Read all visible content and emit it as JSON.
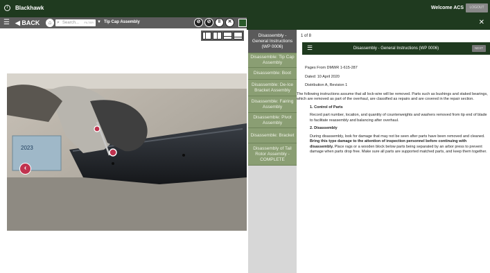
{
  "app": {
    "title": "Blackhawk",
    "welcome": "Welcome ACS",
    "logout_label": "LOGOUT"
  },
  "toolbar": {
    "back_label": "◀ BACK",
    "search_placeholder": "Search...",
    "filter_label": "FILTER",
    "breadcrumb": "Tip Cap Assembly",
    "icons": [
      "no-touch-icon",
      "no-touch-icon",
      "pause-icon",
      "close-icon",
      "square-icon"
    ]
  },
  "nav": {
    "items": [
      {
        "label": "Disassembly - General Instructions (WP 0006)",
        "active": true
      },
      {
        "label": "Disassemble: Tip Cap Assembly",
        "active": false
      },
      {
        "label": "Disassemble: Boot",
        "active": false
      },
      {
        "label": "Disassemble: De-Ice Bracket Assembly",
        "active": false
      },
      {
        "label": "Disassemble: Fairing Assembly",
        "active": false
      },
      {
        "label": "Disassemble: Pivot Assembly",
        "active": false
      },
      {
        "label": "Disassemble: Bracket",
        "active": false
      },
      {
        "label": "Disassembly of Tail Rotor Assembly - COMPLETE",
        "active": false
      }
    ]
  },
  "content": {
    "pager": "1 of 8",
    "header_title": "Disassembly - General Instructions (WP 0006)",
    "next_label": "NEXT",
    "pages_from": "Pages From DMWR 1-615-287",
    "dated": "Dated: 10 April 2020",
    "distribution": "Distribution A, Revision 1",
    "intro": "The following instructions assume that all lock-wire will be removed. Parts such as bushings and staked bearings, which are removed as part of the overhaul, are classified as repairs and are covered in the repair section.",
    "sec1_title": "1. Control of Parts",
    "sec1_body": "Record part number, location, and quantity of counterweights and washers removed from tip end of blade to facilitate reassembly and balancing after overhaul.",
    "sec2_title": "2. Disassembly",
    "sec2_body_a": "During disassembly, look for damage that may not be seen after parts have been removed and cleaned. ",
    "sec2_body_bold": "Bring this type damage to the attention of inspection personnel before continuing with disassembly.",
    "sec2_body_b": " Place rags or a wooden block below parts being separated by an arbor press to prevent damage when parts drop free. Make sure all parts are supported matched parts, and keep them together."
  },
  "colors": {
    "header_green": "#1f3a1f",
    "nav_green": "#8a9e73",
    "toolbar_grey": "#5c5c5c",
    "marker_red": "#c0334f"
  }
}
